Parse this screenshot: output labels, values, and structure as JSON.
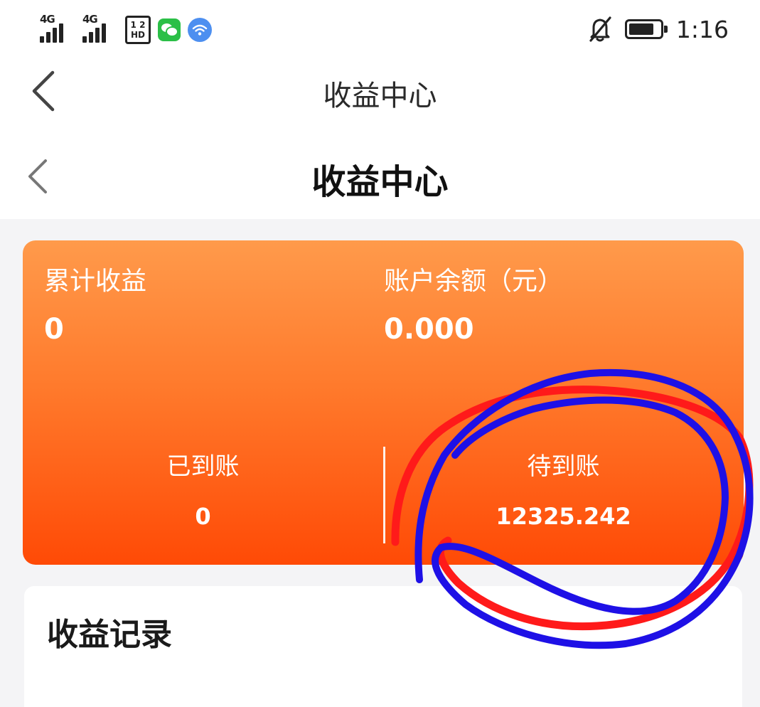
{
  "status_bar": {
    "signal1_label": "4G",
    "signal2_label": "4G",
    "hd_top": "1 2",
    "hd_bottom": "HD",
    "icons": [
      "signal-icon",
      "signal-icon",
      "hd-icon",
      "wechat-icon",
      "wifi-icon",
      "bell-off-icon",
      "battery-icon"
    ],
    "time": "1:16",
    "battery_level": 0.8
  },
  "nav_outer": {
    "title": "收益中心"
  },
  "nav_inner": {
    "title": "收益中心"
  },
  "earnings_card": {
    "total_label": "累计收益",
    "total_value": "0",
    "balance_label": "账户余额（元）",
    "balance_value": "0.000",
    "arrived_label": "已到账",
    "arrived_value": "0",
    "pending_label": "待到账",
    "pending_value": "12325.242"
  },
  "records": {
    "title": "收益记录"
  },
  "colors": {
    "card_top": "#ff9a4b",
    "card_bottom": "#ff4a06",
    "scribble_red": "#ff1a1a",
    "scribble_blue": "#1e10e6"
  }
}
